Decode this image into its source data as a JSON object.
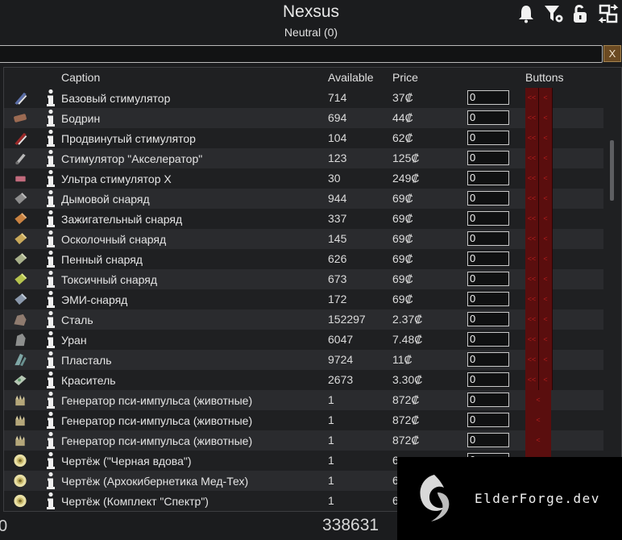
{
  "header": {
    "title": "Nexsus",
    "subtitle": "Neutral (0)"
  },
  "header_icons": [
    "bell-icon",
    "filter-settings-icon",
    "unlock-icon",
    "transfer-icon"
  ],
  "search": {
    "value": "",
    "clear_label": "X"
  },
  "columns": {
    "caption": "Caption",
    "available": "Available",
    "price": "Price",
    "buttons": "Buttons"
  },
  "colors": {
    "background": "#1b1c1e",
    "row_alt": "#2a2b2e",
    "button_red": "#5a0e0e",
    "button_text": "#b21d1d"
  },
  "rows": [
    {
      "icon": "stimulator-icon",
      "caption": "Базовый стимулятор",
      "available": "714",
      "price": "37₡",
      "qty": "0",
      "btn_double": "<<",
      "btn_single": "<"
    },
    {
      "icon": "bodrin-icon",
      "caption": "Бодрин",
      "available": "694",
      "price": "44₡",
      "qty": "0",
      "btn_double": "<<",
      "btn_single": "<"
    },
    {
      "icon": "advanced-stimulator-icon",
      "caption": "Продвинутый стимулятор",
      "available": "104",
      "price": "62₡",
      "qty": "0",
      "btn_double": "<<",
      "btn_single": "<"
    },
    {
      "icon": "accelerator-stimulator-icon",
      "caption": "Стимулятор \"Акселератор\"",
      "available": "123",
      "price": "125₡",
      "qty": "0",
      "btn_double": "<<",
      "btn_single": "<"
    },
    {
      "icon": "ultra-stimulator-icon",
      "caption": "Ультра стимулятор X",
      "available": "30",
      "price": "249₡",
      "qty": "0",
      "btn_double": "<<",
      "btn_single": "<"
    },
    {
      "icon": "smoke-shell-icon",
      "caption": "Дымовой снаряд",
      "available": "944",
      "price": "69₡",
      "qty": "0",
      "btn_double": "<<",
      "btn_single": "<"
    },
    {
      "icon": "incendiary-shell-icon",
      "caption": "Зажигательный снаряд",
      "available": "337",
      "price": "69₡",
      "qty": "0",
      "btn_double": "<<",
      "btn_single": "<"
    },
    {
      "icon": "fragmentation-shell-icon",
      "caption": "Осколочный снаряд",
      "available": "145",
      "price": "69₡",
      "qty": "0",
      "btn_double": "<<",
      "btn_single": "<"
    },
    {
      "icon": "foam-shell-icon",
      "caption": "Пенный снаряд",
      "available": "626",
      "price": "69₡",
      "qty": "0",
      "btn_double": "<<",
      "btn_single": "<"
    },
    {
      "icon": "toxic-shell-icon",
      "caption": "Токсичный снаряд",
      "available": "673",
      "price": "69₡",
      "qty": "0",
      "btn_double": "<<",
      "btn_single": "<"
    },
    {
      "icon": "emp-shell-icon",
      "caption": "ЭМИ-снаряд",
      "available": "172",
      "price": "69₡",
      "qty": "0",
      "btn_double": "<<",
      "btn_single": "<"
    },
    {
      "icon": "steel-icon",
      "caption": "Сталь",
      "available": "152297",
      "price": "2.37₡",
      "qty": "0",
      "btn_double": "<<",
      "btn_single": "<"
    },
    {
      "icon": "uranium-icon",
      "caption": "Уран",
      "available": "6047",
      "price": "7.48₡",
      "qty": "0",
      "btn_double": "<<",
      "btn_single": "<"
    },
    {
      "icon": "plasteel-icon",
      "caption": "Пласталь",
      "available": "9724",
      "price": "11₡",
      "qty": "0",
      "btn_double": "<<",
      "btn_single": "<"
    },
    {
      "icon": "dye-icon",
      "caption": "Краситель",
      "available": "2673",
      "price": "3.30₡",
      "qty": "0",
      "btn_double": "<<",
      "btn_single": "<"
    },
    {
      "icon": "psychic-generator-icon",
      "caption": "Генератор пси-импульса (животные)",
      "available": "1",
      "price": "872₡",
      "qty": "0",
      "btn_double": "",
      "btn_single": "<"
    },
    {
      "icon": "psychic-generator-icon",
      "caption": "Генератор пси-импульса (животные)",
      "available": "1",
      "price": "872₡",
      "qty": "0",
      "btn_double": "",
      "btn_single": "<"
    },
    {
      "icon": "psychic-generator-icon",
      "caption": "Генератор пси-импульса (животные)",
      "available": "1",
      "price": "872₡",
      "qty": "0",
      "btn_double": "",
      "btn_single": "<"
    },
    {
      "icon": "blueprint-icon",
      "caption": "Чертёж (\"Черная вдова\")",
      "available": "1",
      "price": "6",
      "qty": "0",
      "btn_double": "",
      "btn_single": "<"
    },
    {
      "icon": "blueprint-icon",
      "caption": "Чертёж (Архокибернетика Мед-Тех)",
      "available": "1",
      "price": "6",
      "qty": "0",
      "btn_double": "",
      "btn_single": "<"
    },
    {
      "icon": "blueprint-icon",
      "caption": "Чертёж (Комплект \"Спектр\")",
      "available": "1",
      "price": "6",
      "qty": "0",
      "btn_double": "",
      "btn_single": "<"
    }
  ],
  "footer": {
    "left_value": "0",
    "total": "338631"
  },
  "watermark": {
    "text": "ElderForge.dev"
  }
}
